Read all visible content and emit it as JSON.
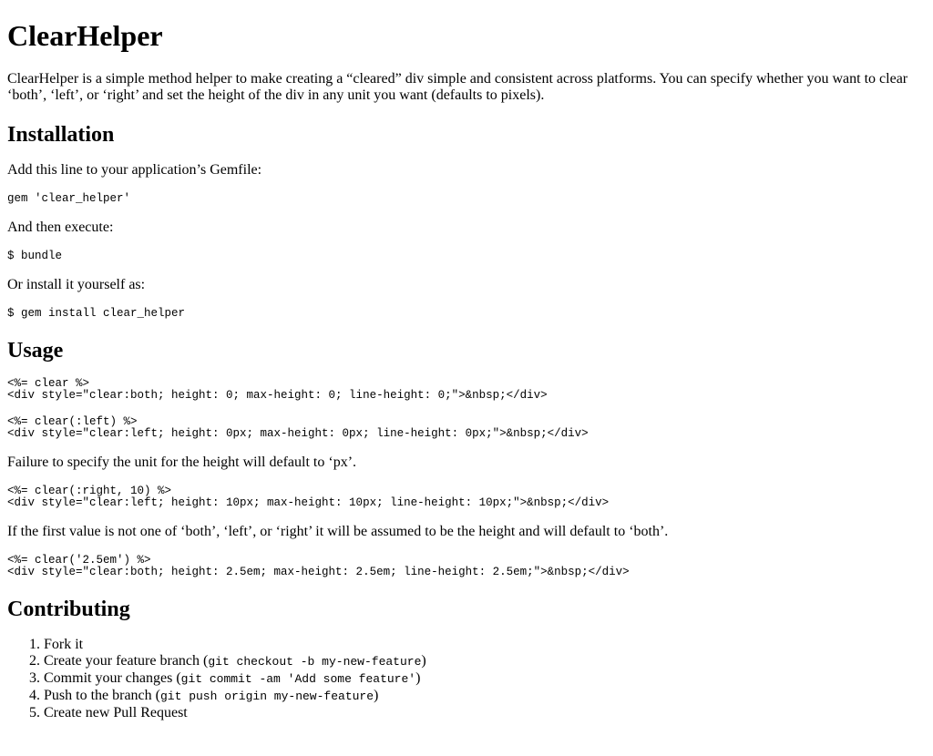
{
  "title": "ClearHelper",
  "intro": "ClearHelper is a simple method helper to make creating a “cleared” div simple and consistent across platforms. You can specify whether you want to clear ‘both’, ‘left’, or ‘right’ and set the height of the div in any unit you want (defaults to pixels).",
  "installation": {
    "heading": "Installation",
    "gemfile_text": "Add this line to your application’s Gemfile:",
    "gemfile_code": "gem 'clear_helper'",
    "execute_text": "And then execute:",
    "execute_code": "$ bundle",
    "self_text": "Or install it yourself as:",
    "self_code": "$ gem install clear_helper"
  },
  "usage": {
    "heading": "Usage",
    "example1": "<%= clear %>\n<div style=\"clear:both; height: 0; max-height: 0; line-height: 0;\">&nbsp;</div>",
    "example2": "<%= clear(:left) %>\n<div style=\"clear:left; height: 0px; max-height: 0px; line-height: 0px;\">&nbsp;</div>",
    "note1": "Failure to specify the unit for the height will default to ‘px’.",
    "example3": "<%= clear(:right, 10) %>\n<div style=\"clear:left; height: 10px; max-height: 10px; line-height: 10px;\">&nbsp;</div>",
    "note2": "If the first value is not one of ‘both’, ‘left’, or ‘right’ it will be assumed to be the height and will default to ‘both’.",
    "example4": "<%= clear('2.5em') %>\n<div style=\"clear:both; height: 2.5em; max-height: 2.5em; line-height: 2.5em;\">&nbsp;</div>"
  },
  "contributing": {
    "heading": "Contributing",
    "steps": [
      {
        "text": "Fork it",
        "code": "",
        "after": ""
      },
      {
        "text": "Create your feature branch (",
        "code": "git checkout -b my-new-feature",
        "after": ")"
      },
      {
        "text": "Commit your changes (",
        "code": "git commit -am 'Add some feature'",
        "after": ")"
      },
      {
        "text": "Push to the branch (",
        "code": "git push origin my-new-feature",
        "after": ")"
      },
      {
        "text": "Create new Pull Request",
        "code": "",
        "after": ""
      }
    ]
  }
}
